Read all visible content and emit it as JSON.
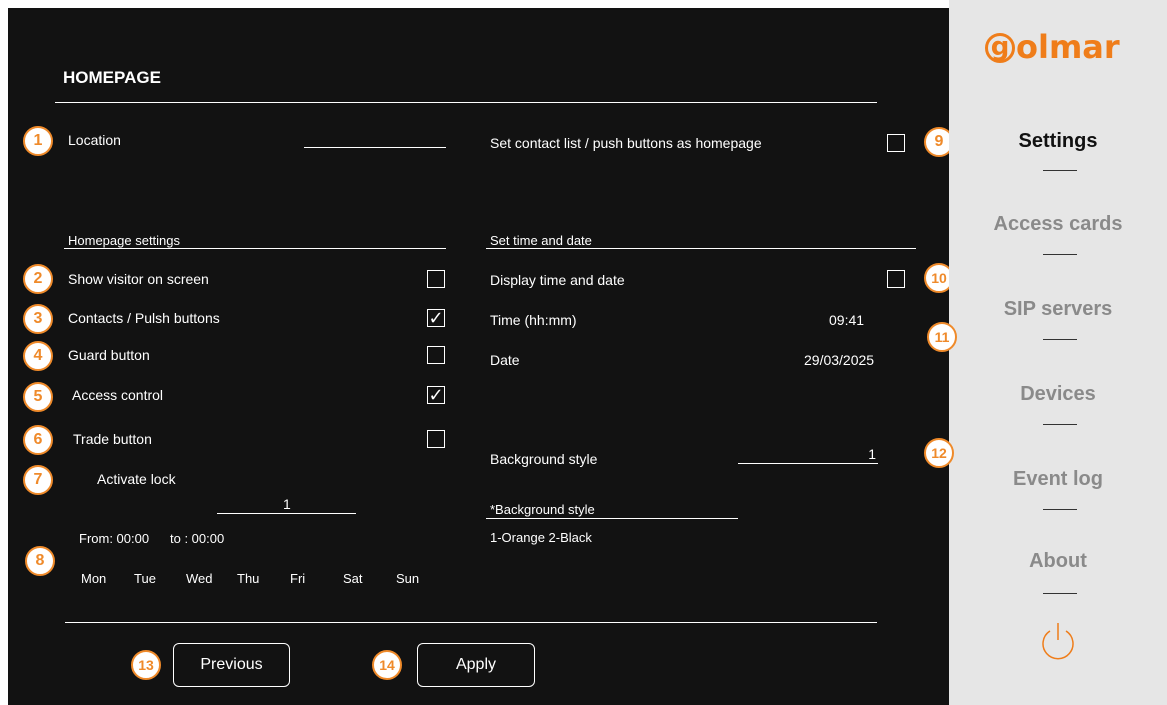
{
  "page_title": "HOMEPAGE",
  "location": {
    "label": "Location",
    "value": ""
  },
  "contact_homepage": {
    "label": "Set contact list / push buttons as homepage",
    "checked": false
  },
  "homepage_settings": {
    "heading": "Homepage settings",
    "items": [
      {
        "label": "Show visitor on screen",
        "checked": false,
        "mark": ""
      },
      {
        "label": "Contacts / Pulsh buttons",
        "checked": true,
        "mark": "✓"
      },
      {
        "label": "Guard button",
        "checked": false,
        "mark": ""
      },
      {
        "label": "Access control",
        "checked": true,
        "mark": "✓"
      },
      {
        "label": "Trade button",
        "checked": false,
        "mark": ""
      }
    ]
  },
  "activate_lock": {
    "label": "Activate lock",
    "value": "1"
  },
  "schedule": {
    "from": "From: 00:00",
    "to": "to : 00:00",
    "days": [
      "Mon",
      "Tue",
      "Wed",
      "Thu",
      "Fri",
      "Sat",
      "Sun"
    ]
  },
  "time_date": {
    "heading": "Set time and date",
    "display_label": "Display time and date",
    "display_checked": false,
    "time_label": "Time (hh:mm)",
    "time_value": "09:41",
    "date_label": "Date",
    "date_value": "29/03/2025"
  },
  "background": {
    "label": "Background style",
    "value": "1",
    "note_heading": "*Background style",
    "note_text": "1-Orange 2-Black"
  },
  "buttons": {
    "previous": "Previous",
    "apply": "Apply"
  },
  "callouts": [
    "1",
    "2",
    "3",
    "4",
    "5",
    "6",
    "7",
    "8",
    "9",
    "10",
    "11",
    "12",
    "13",
    "14"
  ],
  "sidebar": {
    "brand": "olmar",
    "brand_initial": "g",
    "items": [
      {
        "label": "Settings",
        "active": true
      },
      {
        "label": "Access cards",
        "active": false
      },
      {
        "label": "SIP servers",
        "active": false
      },
      {
        "label": "Devices",
        "active": false
      },
      {
        "label": "Event log",
        "active": false
      },
      {
        "label": "About",
        "active": false
      }
    ],
    "power_icon": "power-icon"
  },
  "colors": {
    "accent": "#ef8a2a",
    "screen_bg": "#121212",
    "sidebar_bg": "#e6e6e6"
  }
}
